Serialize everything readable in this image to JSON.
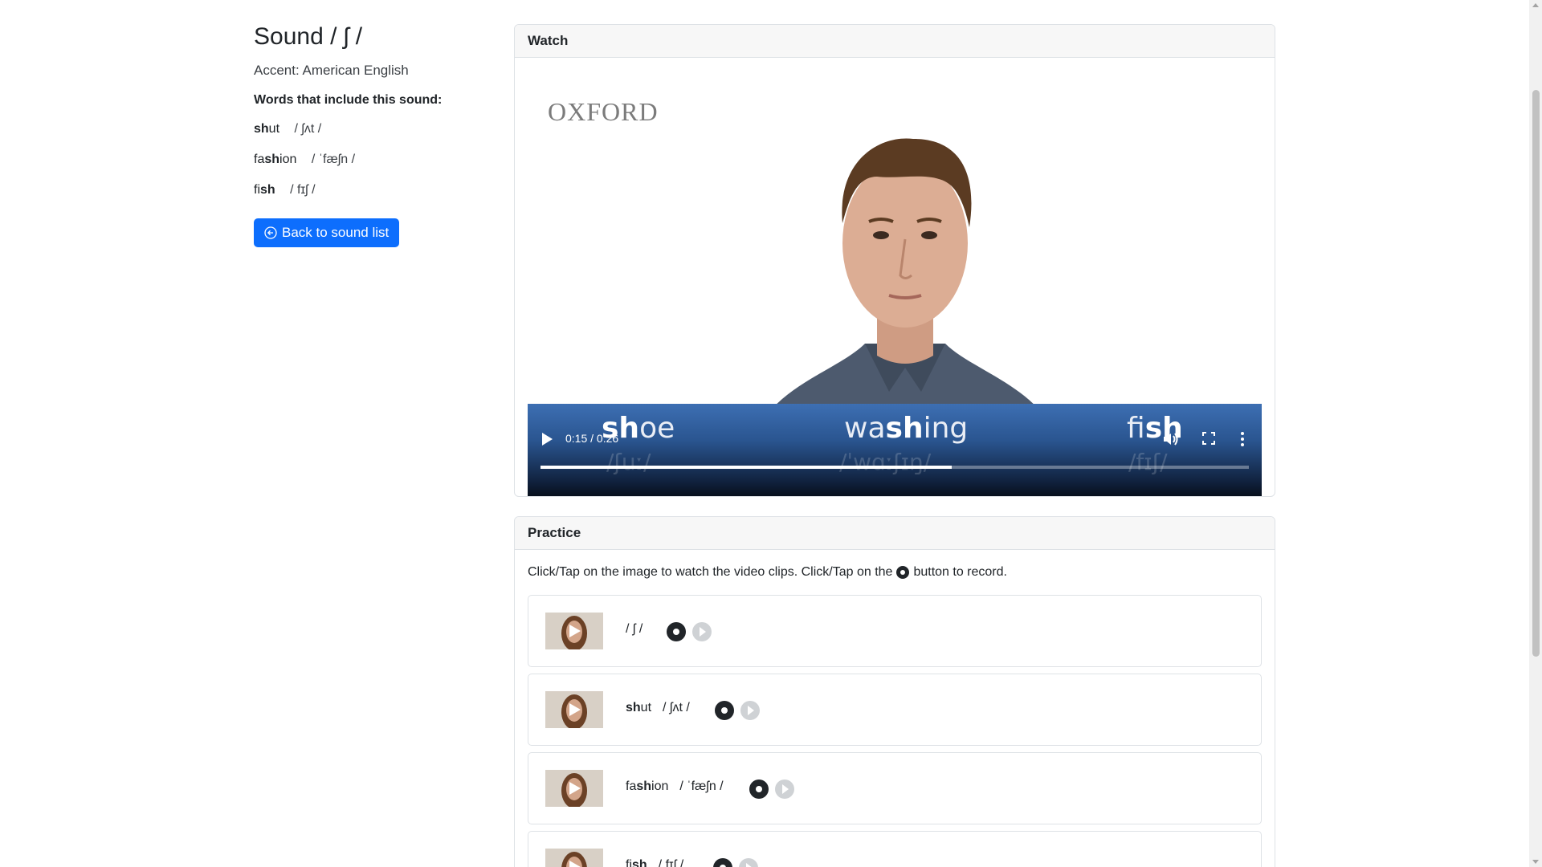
{
  "sound": {
    "title": "Sound / ʃ /",
    "accent": "Accent: American English",
    "words_heading": "Words that include this sound:",
    "words": [
      {
        "pre": "",
        "bold": "sh",
        "post": "ut",
        "ipa": "/ ʃʌt /"
      },
      {
        "pre": "fa",
        "bold": "sh",
        "post": "ion",
        "ipa": "/ ˈfæʃn /"
      },
      {
        "pre": "fi",
        "bold": "sh",
        "post": "",
        "ipa": "/ fɪʃ /"
      }
    ],
    "back_button": "Back to sound list",
    "back_icon": "arrow-left-circle-icon"
  },
  "watch": {
    "header": "Watch",
    "logo": "OXFORD",
    "banner_words": [
      {
        "pre": "",
        "bold": "sh",
        "post": "oe",
        "ipa": "/ʃuː/"
      },
      {
        "pre": "wa",
        "bold": "sh",
        "post": "ing",
        "ipa": "/ˈwɑːʃɪŋ/"
      },
      {
        "pre": "fi",
        "bold": "sh",
        "post": "",
        "ipa": "/fɪʃ/"
      }
    ],
    "time": "0:15 / 0:26",
    "progress": 0.58,
    "icons": {
      "play": "play-icon",
      "volume": "volume-icon",
      "fullscreen": "fullscreen-icon",
      "more": "more-vertical-icon"
    }
  },
  "practice": {
    "header": "Practice",
    "instruction_before": "Click/Tap on the image to watch the video clips. Click/Tap on the",
    "instruction_after": "button to record.",
    "rows": [
      {
        "pre": "",
        "bold": "",
        "post": "",
        "ipa": "/ ʃ /"
      },
      {
        "pre": "",
        "bold": "sh",
        "post": "ut",
        "ipa": "/ ʃʌt /"
      },
      {
        "pre": "fa",
        "bold": "sh",
        "post": "ion",
        "ipa": "/ ˈfæʃn /"
      },
      {
        "pre": "fi",
        "bold": "sh",
        "post": "",
        "ipa": "/ fɪʃ /"
      }
    ]
  },
  "colors": {
    "primary": "#0d6efd",
    "record": "#212529",
    "play_disabled": "#cfd2d5"
  }
}
